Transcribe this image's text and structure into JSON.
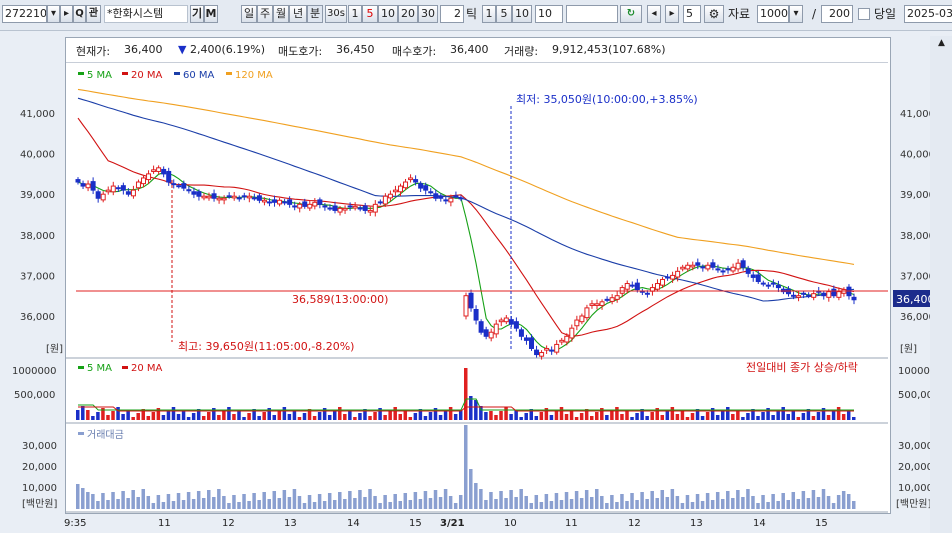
{
  "toolbar": {
    "code": "272210",
    "name": "*한화시스템",
    "search_label": "Q",
    "gwan_label": "관",
    "gi_label": "기",
    "m_label": "M",
    "period_buttons": [
      "일",
      "주",
      "월",
      "년",
      "분"
    ],
    "sec_label": "30s",
    "minute_buttons": [
      "1",
      "5",
      "10",
      "20",
      "30"
    ],
    "minute_selected": "5",
    "tick_value": "2",
    "tick_label": "틱",
    "tick_buttons": [
      "1",
      "5",
      "10"
    ],
    "tick_field": "10",
    "count_field": "5",
    "data_label": "자료",
    "data_count": "1000",
    "slash": "/",
    "total_count": "200",
    "today_label": "당일",
    "date_value": "2025-03-"
  },
  "info": {
    "current_label": "현재가:",
    "current_value": "36,400",
    "change_value": "2,400(6.19%)",
    "ask_label": "매도호가:",
    "ask_value": "36,450",
    "bid_label": "매수호가:",
    "bid_value": "36,400",
    "volume_label": "거래량:",
    "volume_value": "9,912,453(107.68%)"
  },
  "colors": {
    "up": "#e02020",
    "down": "#1a2fc8",
    "ma5": "#16a116",
    "ma20": "#d11212",
    "ma60": "#1b3ea8",
    "ma120": "#f0a020",
    "amount": "#8a9fd0"
  },
  "price_panel": {
    "legend": [
      "5 MA",
      "20 MA",
      "60 MA",
      "120 MA"
    ],
    "y_ticks": [
      "41,000",
      "40,000",
      "39,000",
      "38,000",
      "37,000",
      "36,000"
    ],
    "unit": "[원]",
    "ref_label": "36,589(13:00:00)",
    "current_tag": "36,400",
    "low_note": "최저: 35,050원(10:00:00,+3.85%)",
    "high_note": "최고: 39,650원(11:05:00,-8.20%)"
  },
  "volume_panel": {
    "legend": [
      "5 MA",
      "20 MA"
    ],
    "y_ticks": [
      "1000000",
      "500,000"
    ],
    "note": "전일대비 종가 상승/하락"
  },
  "amount_panel": {
    "legend": "거래대금",
    "y_ticks": [
      "30,000",
      "20,000",
      "10,000"
    ],
    "unit": "[백만원]"
  },
  "x_axis": {
    "labels": [
      "9:35",
      "11",
      "12",
      "13",
      "14",
      "15",
      "3/21",
      "10",
      "11",
      "12",
      "13",
      "14",
      "15"
    ]
  },
  "chart_data": {
    "type": "candlestick",
    "price_range": [
      35000,
      41800
    ],
    "ref_price": 36589,
    "current_price": 36400,
    "day1_close_series": [
      39300,
      39200,
      39250,
      39100,
      38900,
      39000,
      39100,
      39200,
      39150,
      39100,
      39000,
      39100,
      39300,
      39400,
      39500,
      39600,
      39650,
      39500,
      39300,
      39250,
      39200,
      39150,
      39100,
      39000,
      38950,
      38950,
      38950,
      38900,
      38900,
      38900,
      38950,
      38950,
      38900,
      38950,
      38950,
      38900,
      38850,
      38850,
      38800,
      38800,
      38850,
      38800,
      38750,
      38700,
      38750,
      38700,
      38750,
      38800,
      38750,
      38700,
      38650,
      38600,
      38650,
      38650,
      38700,
      38700,
      38650,
      38600,
      38600,
      38750,
      38800,
      38950,
      39000,
      39100,
      39200,
      39300,
      39400,
      39300,
      39150,
      39100,
      39050,
      38900,
      38900,
      38850,
      38900,
      38950,
      38900
    ],
    "day2_close_series": [
      36500,
      36200,
      35900,
      35600,
      35500,
      35600,
      35800,
      35900,
      35950,
      35800,
      35700,
      35500,
      35400,
      35200,
      35050,
      35100,
      35200,
      35150,
      35300,
      35400,
      35500,
      35700,
      35900,
      36000,
      36200,
      36300,
      36300,
      36350,
      36400,
      36450,
      36500,
      36700,
      36800,
      36750,
      36650,
      36600,
      36550,
      36700,
      36800,
      36900,
      36950,
      37000,
      37100,
      37200,
      37250,
      37250,
      37250,
      37200,
      37250,
      37200,
      37150,
      37100,
      37150,
      37200,
      37300,
      37200,
      37050,
      36950,
      36850,
      36800,
      36750,
      36800,
      36700,
      36600,
      36550,
      36500,
      36500,
      36550,
      36500,
      36550,
      36600,
      36500,
      36600,
      36500,
      36600,
      36650,
      36500,
      36400
    ],
    "volume_range": [
      0,
      1050000
    ],
    "amount_range": [
      0,
      40000
    ],
    "amount_unit": "백만원"
  }
}
